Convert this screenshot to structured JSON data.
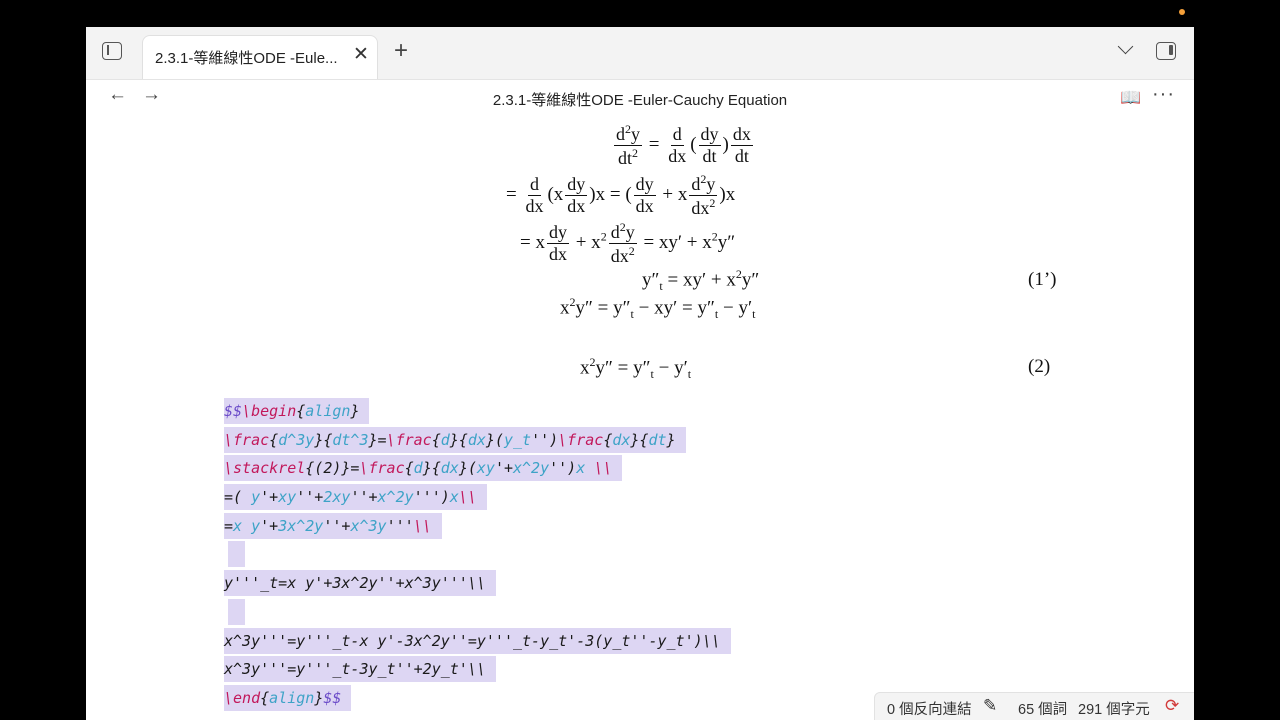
{
  "tab": {
    "title": "2.3.1-等維線性ODE -Eule...",
    "close": "✕",
    "new_tab": "+"
  },
  "nav": {
    "back": "←",
    "forward": "→",
    "title": "2.3.1-等維線性ODE -Euler-Cauchy Equation",
    "reading_icon": "📖",
    "more": "···"
  },
  "equations": {
    "eq1_label": "(1’)",
    "eq2_label": "(2)"
  },
  "source_lines": [
    "$$\\begin{align}",
    "\\frac{d^3y}{dt^3}=\\frac{d}{dx}(y_t'')\\frac{dx}{dt}",
    "\\stackrel{(2)}=\\frac{d}{dx}(xy'+x^2y'')x \\\\",
    "=( y'+xy''+2xy''+x^2y''')x\\\\",
    "=x y'+3x^2y''+x^3y'''\\\\",
    "",
    "y'''_t=x y'+3x^2y''+x^3y'''\\\\",
    "",
    "x^3y'''=y'''_t-x y'-3x^2y''=y'''_t-y_t'-3(y_t''-y_t')\\\\",
    "x^3y'''=y'''_t-3y_t''+2y_t'\\\\",
    "\\end{align}$$"
  ],
  "status": {
    "backlinks": "0 個反向連結",
    "words": "65 個詞",
    "chars": "291 個字元"
  }
}
